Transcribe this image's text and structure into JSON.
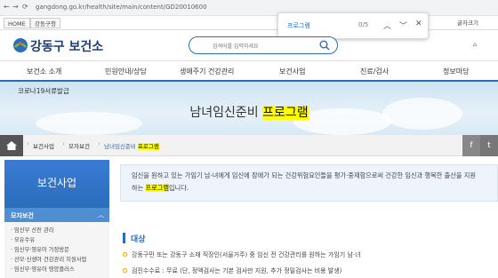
{
  "browser": {
    "url": "gangdong.go.kr/health/site/main/content/GD20010600",
    "tabs": [
      "HOME",
      "강동구청"
    ],
    "bookmark_label": "글자크기"
  },
  "find": {
    "query": "프로그램",
    "count": "0/5"
  },
  "site": {
    "logo": "강동구 보건소",
    "search_placeholder": "검색어를 입력하세요",
    "gnb": [
      "보건소 소개",
      "민원안내/상담",
      "생애주기 건강관리",
      "보건사업",
      "진료/검사",
      "정보마당"
    ],
    "util": "코로나19서류발급"
  },
  "banner": {
    "title_pre": "남녀임신준비 ",
    "title_hl": "프로그램"
  },
  "breadcrumb": {
    "items": [
      "보건사업",
      "모자보건"
    ],
    "current_pre": "남녀임신준비 ",
    "current_hl": "프로그램"
  },
  "sidebar": {
    "title": "보건사업",
    "sub": "모자보건",
    "items": [
      "· 임신부 산전 관리",
      "· 모유수유",
      "· 임신부·영유아 가정방문",
      "· 산모·신생아 건강관리 지원사업",
      "· 임신부·영유아 영양플러스"
    ]
  },
  "content": {
    "intro_line1": "임신을 원하고 있는 가임기 남·녀에게 임신에 장애가 되는 건강위험요인들을 평가·중재함으로써 건강한 임신과 행복한 출산을 지원",
    "intro_line2_pre": "하는 ",
    "intro_line2_hl": "프로그램",
    "intro_line2_post": "입니다.",
    "section_title": "대상",
    "bullets": [
      "강동구민 또는 강동구 소재 직장인(서울거주) 중 임신 전 건강관리를 원하는 가임기 남·녀",
      "검진수수료 : 무료 (단, 정액검사는 기본 검사만 지원, 추가 정밀검사는 비용 발생)"
    ]
  },
  "colors": {
    "brand": "#2a6ebb",
    "highlight": "#ffff00",
    "bullet": "#e8a317"
  }
}
